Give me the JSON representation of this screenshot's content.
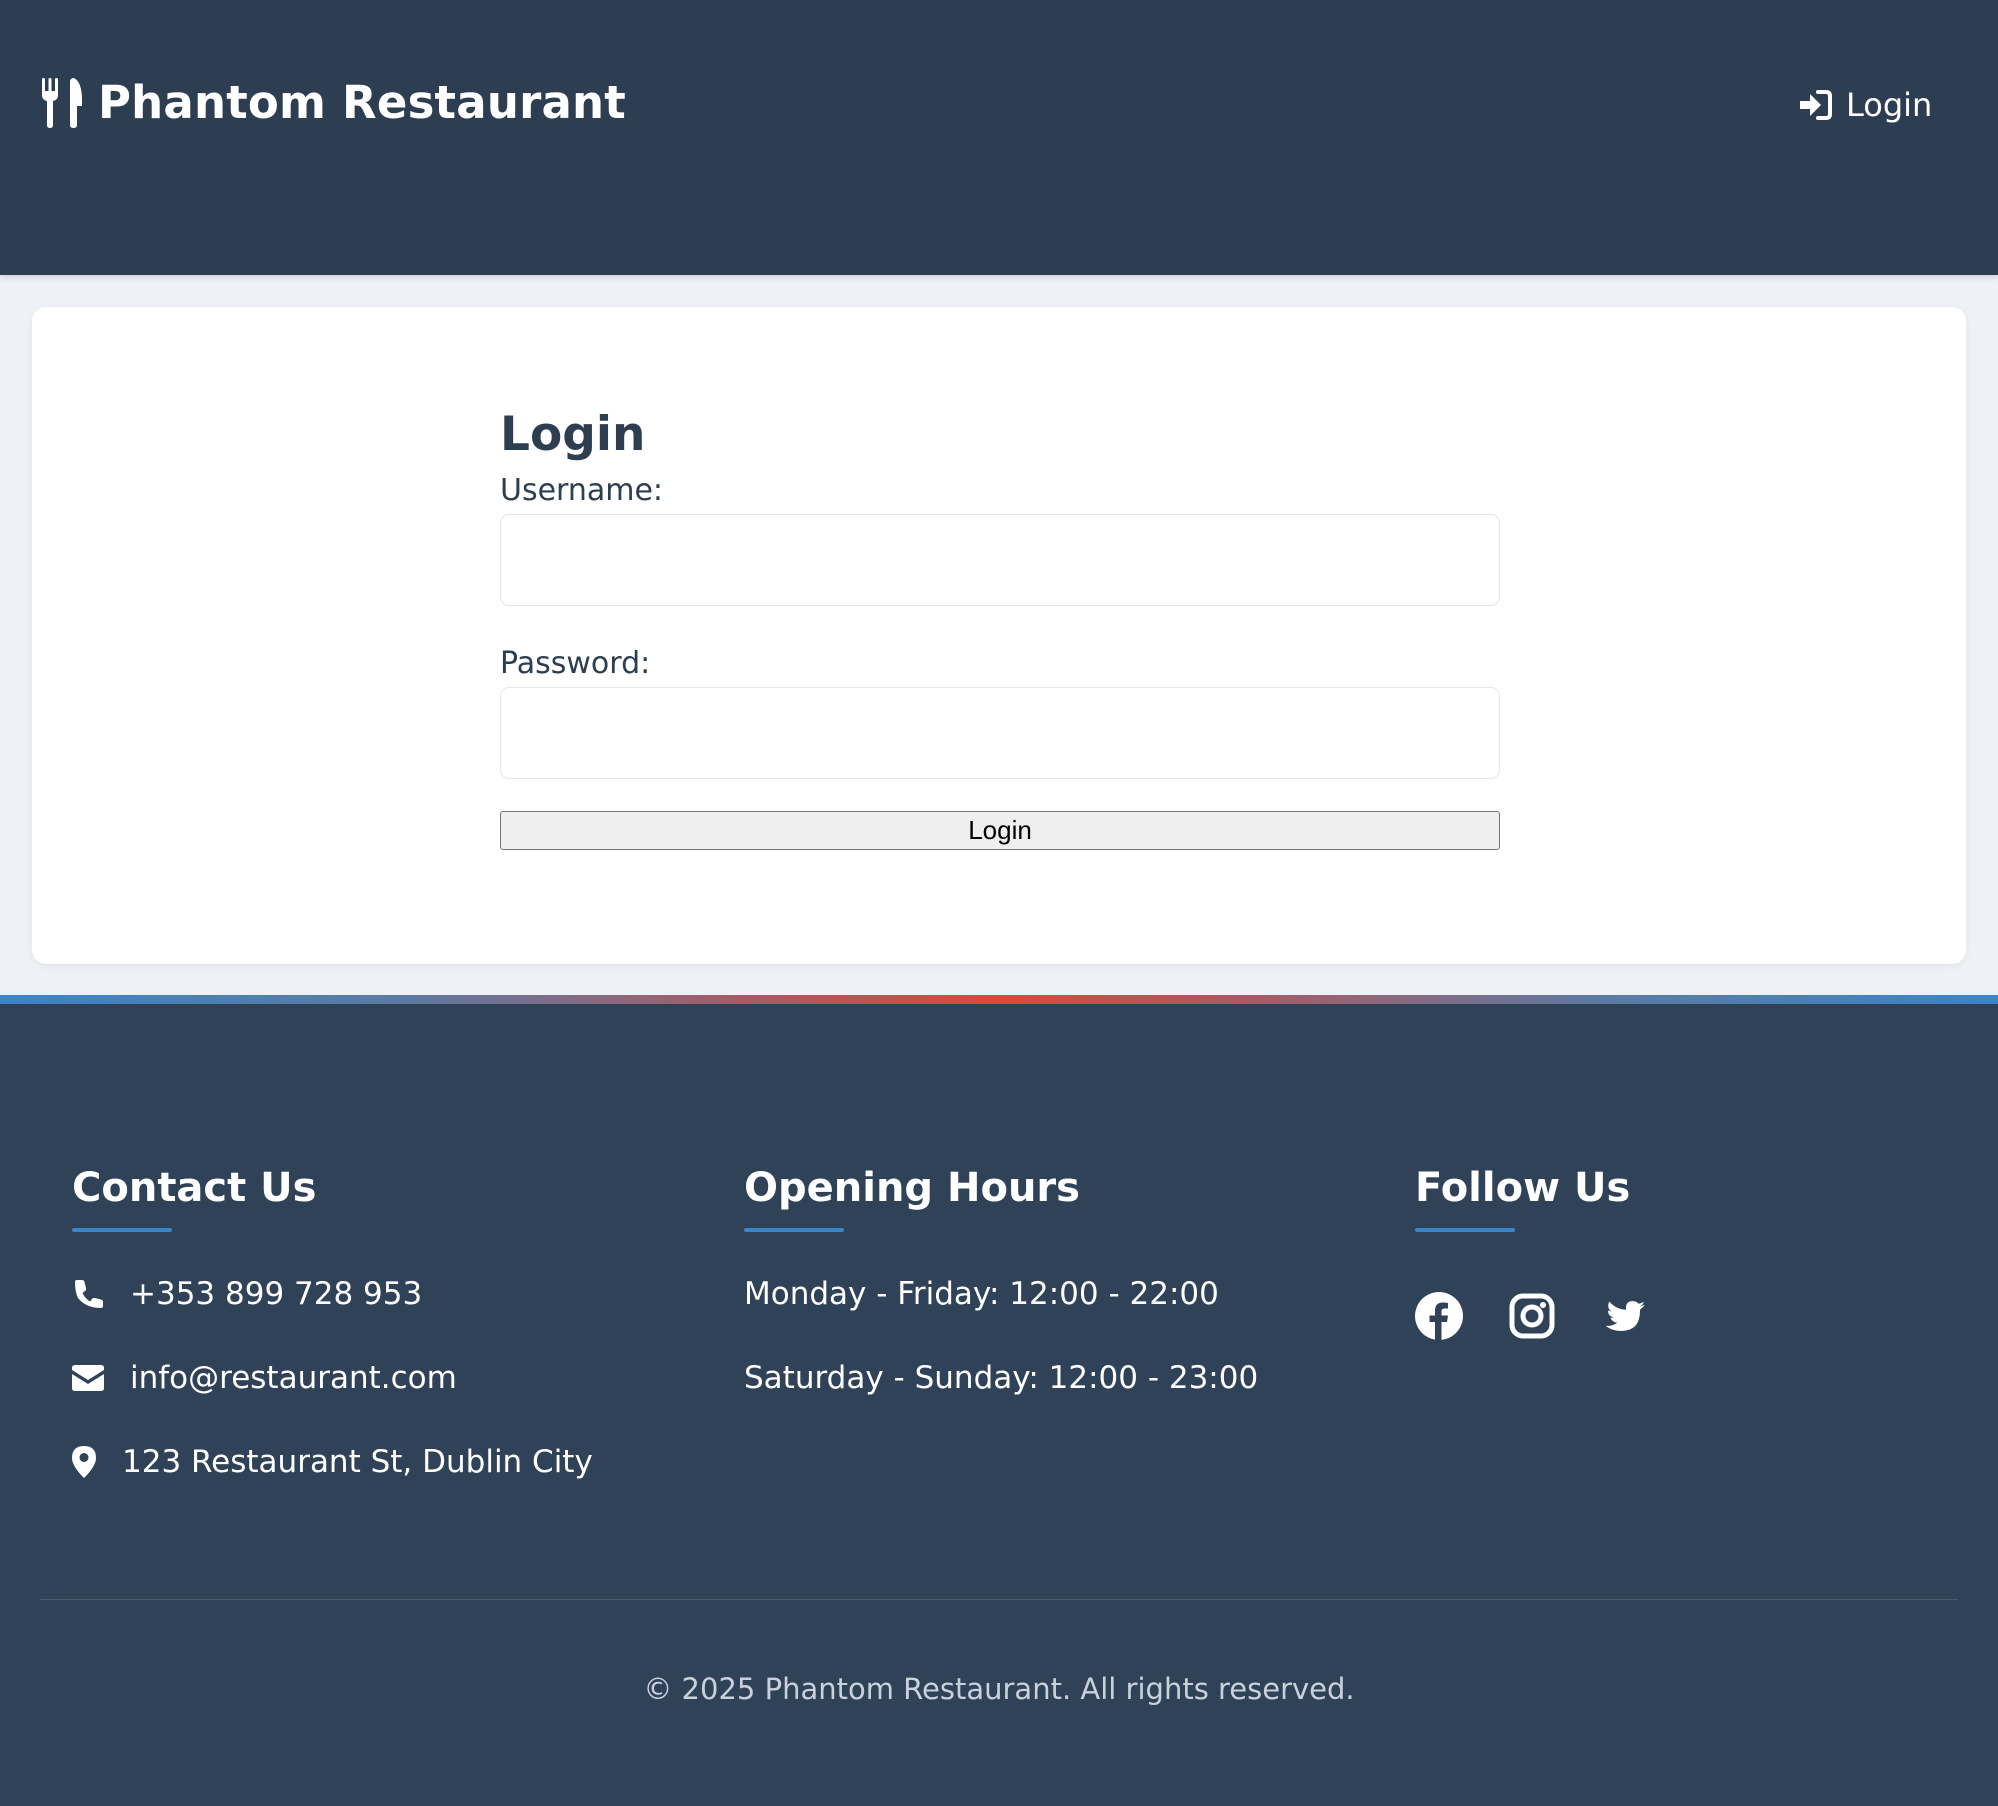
{
  "header": {
    "brand_name": "Phantom Restaurant",
    "brand_icon": "utensils-icon",
    "nav_login_label": "Login",
    "nav_login_icon": "sign-in-icon"
  },
  "login_form": {
    "title": "Login",
    "username_label": "Username:",
    "username_value": "",
    "password_label": "Password:",
    "password_value": "",
    "submit_label": "Login"
  },
  "footer": {
    "contact": {
      "heading": "Contact Us",
      "phone": "+353 899 728 953",
      "email": "info@restaurant.com",
      "address": "123 Restaurant St, Dublin City"
    },
    "hours": {
      "heading": "Opening Hours",
      "weekdays": "Monday - Friday: 12:00 - 22:00",
      "weekend": "Saturday - Sunday: 12:00 - 23:00"
    },
    "follow": {
      "heading": "Follow Us",
      "icons": [
        "facebook-icon",
        "instagram-icon",
        "twitter-icon"
      ]
    },
    "copyright": "© 2025 Phantom Restaurant. All rights reserved."
  },
  "colors": {
    "header_bg": "#2e3e52",
    "footer_bg": "#2f4257",
    "accent_blue": "#3a86c8",
    "accent_red": "#e0453a",
    "page_bg": "#eef1f5",
    "text_dark": "#2c3e50"
  }
}
